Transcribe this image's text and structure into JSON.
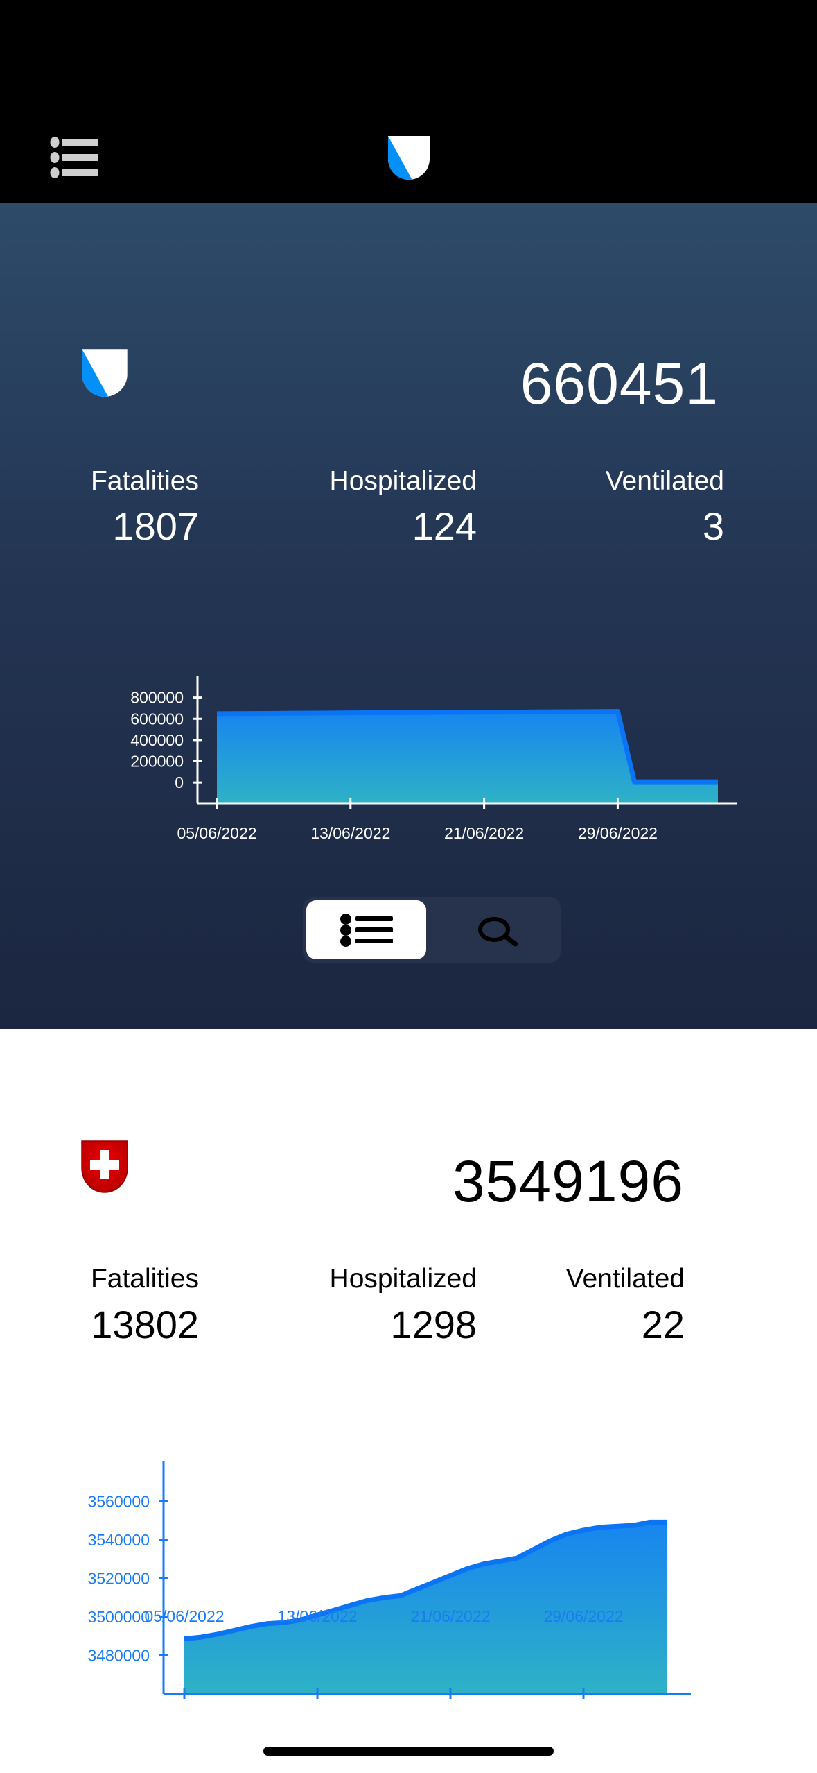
{
  "header": {
    "menu_icon": "list-bullet-icon",
    "logo_icon": "zurich-coat-of-arms-icon"
  },
  "region": {
    "flag_icon": "zurich-coat-of-arms-icon",
    "total": "660451",
    "stats": [
      {
        "label": "Fatalities",
        "value": "1807"
      },
      {
        "label": "Hospitalized",
        "value": "124"
      },
      {
        "label": "Ventilated",
        "value": "3"
      }
    ]
  },
  "segmented_control": {
    "options": [
      {
        "icon": "list-bullet-icon",
        "selected": true
      },
      {
        "icon": "magnifying-glass-icon",
        "selected": false
      }
    ]
  },
  "country": {
    "flag_icon": "swiss-coat-of-arms-icon",
    "total": "3549196",
    "stats": [
      {
        "label": "Fatalities",
        "value": "13802"
      },
      {
        "label": "Hospitalized",
        "value": "1298"
      },
      {
        "label": "Ventilated",
        "value": "22"
      }
    ]
  },
  "colors": {
    "line": "#0a74f5",
    "fill_top": "#1785f0",
    "fill_bottom": "#2eb2c6",
    "country_axis": "#1a7cf5",
    "region_axis": "#ffffff"
  },
  "chart_data": [
    {
      "type": "area",
      "ylim": [
        -195000,
        1000000
      ],
      "y_ticks": [
        "800000",
        "600000",
        "400000",
        "200000",
        "0"
      ],
      "x_ticks": [
        "05/06/2022",
        "13/06/2022",
        "21/06/2022",
        "29/06/2022"
      ],
      "x": [
        "05/06/2022",
        "06/06/2022",
        "07/06/2022",
        "08/06/2022",
        "09/06/2022",
        "10/06/2022",
        "11/06/2022",
        "12/06/2022",
        "13/06/2022",
        "14/06/2022",
        "15/06/2022",
        "16/06/2022",
        "17/06/2022",
        "18/06/2022",
        "19/06/2022",
        "20/06/2022",
        "21/06/2022",
        "22/06/2022",
        "23/06/2022",
        "24/06/2022",
        "25/06/2022",
        "26/06/2022",
        "27/06/2022",
        "28/06/2022",
        "29/06/2022",
        "30/06/2022",
        "01/07/2022",
        "02/07/2022",
        "03/07/2022",
        "04/07/2022",
        "05/07/2022"
      ],
      "values": [
        648000,
        649000,
        650000,
        651000,
        652000,
        653000,
        654000,
        655000,
        656000,
        657000,
        657500,
        658000,
        659000,
        660000,
        660500,
        661000,
        662000,
        663000,
        664000,
        665000,
        666000,
        667000,
        668000,
        669000,
        670000,
        6500,
        6500,
        6500,
        6500,
        6500,
        6500
      ],
      "grid": false
    },
    {
      "type": "area",
      "ylim": [
        3460000,
        3581000
      ],
      "y_ticks": [
        "3560000",
        "3540000",
        "3520000",
        "3500000",
        "3480000"
      ],
      "x_ticks": [
        "05/06/2022",
        "13/06/2022",
        "21/06/2022",
        "29/06/2022"
      ],
      "x": [
        "05/06/2022",
        "06/06/2022",
        "07/06/2022",
        "08/06/2022",
        "09/06/2022",
        "10/06/2022",
        "11/06/2022",
        "12/06/2022",
        "13/06/2022",
        "14/06/2022",
        "15/06/2022",
        "16/06/2022",
        "17/06/2022",
        "18/06/2022",
        "19/06/2022",
        "20/06/2022",
        "21/06/2022",
        "22/06/2022",
        "23/06/2022",
        "24/06/2022",
        "25/06/2022",
        "26/06/2022",
        "27/06/2022",
        "28/06/2022",
        "29/06/2022",
        "30/06/2022",
        "01/07/2022",
        "02/07/2022",
        "03/07/2022",
        "04/07/2022"
      ],
      "values": [
        3488600,
        3489500,
        3491000,
        3493000,
        3495000,
        3496500,
        3497000,
        3498500,
        3501000,
        3503500,
        3506000,
        3508500,
        3510000,
        3511000,
        3514500,
        3518000,
        3521500,
        3525000,
        3527500,
        3529000,
        3530500,
        3535000,
        3539500,
        3543000,
        3545000,
        3546500,
        3547000,
        3547500,
        3549196,
        3549196
      ],
      "grid": false
    }
  ]
}
